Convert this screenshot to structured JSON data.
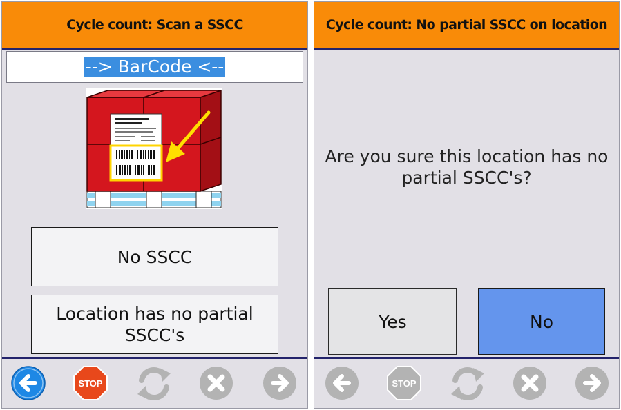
{
  "left_screen": {
    "title": "Cycle count: Scan a SSCC",
    "barcode_field": {
      "value": "--> BarCode <--"
    },
    "image": {
      "label": "pallet-sscc-label-illustration"
    },
    "buttons": {
      "no_sscc": "No SSCC",
      "no_partial": "Location has no partial SSCC's"
    },
    "footer": {
      "back": {
        "icon": "back-arrow-icon",
        "enabled": true
      },
      "stop": {
        "icon": "stop-sign-icon",
        "label": "STOP",
        "enabled": true
      },
      "refresh": {
        "icon": "refresh-icon",
        "enabled": false
      },
      "cancel": {
        "icon": "cancel-icon",
        "enabled": false
      },
      "forward": {
        "icon": "forward-arrow-icon",
        "enabled": false
      }
    }
  },
  "right_screen": {
    "title": "Cycle count: No partial SSCC on location",
    "question": "Are you sure this location has no partial SSCC's?",
    "buttons": {
      "yes": "Yes",
      "no": "No"
    },
    "footer": {
      "back": {
        "icon": "back-arrow-icon",
        "enabled": false
      },
      "stop": {
        "icon": "stop-sign-icon",
        "label": "STOP",
        "enabled": false
      },
      "refresh": {
        "icon": "refresh-icon",
        "enabled": false
      },
      "cancel": {
        "icon": "cancel-icon",
        "enabled": false
      },
      "forward": {
        "icon": "forward-arrow-icon",
        "enabled": false
      }
    }
  },
  "colors": {
    "header": "#f98b08",
    "header_rule": "#23236b",
    "background": "#e2e0e6",
    "selected_button": "#6495ed",
    "barcode_selection": "#3b8ee0",
    "back_active": "#1e88e5",
    "stop_active": "#e8481b",
    "disabled_icon": "#b3b3b3"
  }
}
